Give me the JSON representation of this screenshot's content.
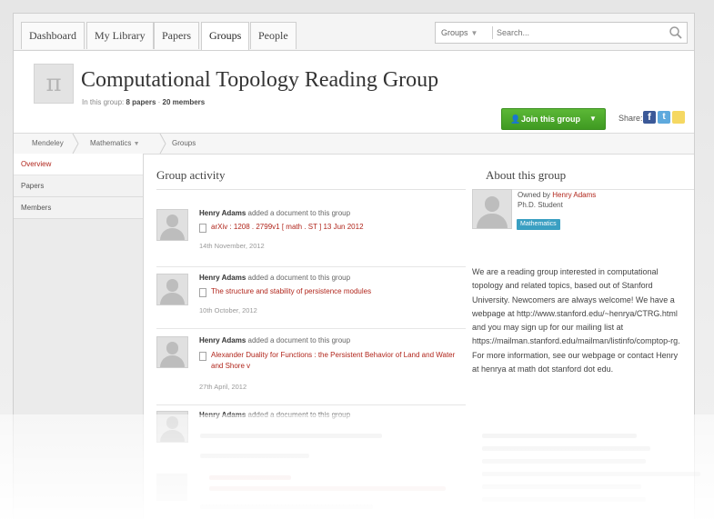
{
  "nav": {
    "tabs": [
      {
        "label": "Dashboard",
        "active": false
      },
      {
        "label": "My Library",
        "active": false
      },
      {
        "label": "Papers",
        "active": false
      },
      {
        "label": "Groups",
        "active": true
      },
      {
        "label": "People",
        "active": false
      }
    ],
    "search": {
      "scope": "Groups",
      "placeholder": "Search..."
    }
  },
  "group": {
    "logo_glyph": "π",
    "title": "Computational Topology Reading Group",
    "meta": {
      "prefix": "In this group:",
      "papers": "8 papers",
      "members": "20 members"
    },
    "join_label": "Join this group",
    "share_label": "Share:"
  },
  "breadcrumb": [
    "Mendeley",
    "Mathematics",
    "Groups"
  ],
  "sidebar": {
    "items": [
      {
        "label": "Overview",
        "active": true
      },
      {
        "label": "Papers",
        "active": false
      },
      {
        "label": "Members",
        "active": false
      }
    ]
  },
  "activity": {
    "heading": "Group activity",
    "items": [
      {
        "user": "Henry Adams",
        "action": "added a document to this group",
        "doc": "arXiv : 1208 . 2799v1 [ math . ST ] 13 Jun 2012",
        "date": "14th November, 2012"
      },
      {
        "user": "Henry Adams",
        "action": "added a document to this group",
        "doc": "The structure and stability of persistence modules",
        "date": "10th October, 2012"
      },
      {
        "user": "Henry Adams",
        "action": "added a document to this group",
        "doc": "Alexander Duality for Functions : the Persistent Behavior of Land and Water and Shore v",
        "date": "27th April, 2012"
      },
      {
        "user": "Henry Adams",
        "action": "added a document to this group",
        "doc": "",
        "date": ""
      }
    ]
  },
  "about": {
    "heading": "About this group",
    "owned_by_prefix": "Owned by",
    "owner": "Henry Adams",
    "owner_title": "Ph.D. Student",
    "tag": "Mathematics",
    "description": "We are a reading group interested in computational topology and related topics, based out of Stanford University. Newcomers are always welcome! We have a webpage at http://www.stanford.edu/~henrya/CTRG.html and you may sign up for our mailing list at https://mailman.stanford.edu/mailman/listinfo/comptop-rg. For more information, see our webpage or contact Henry at henrya at math dot stanford dot edu."
  },
  "colors": {
    "accent": "#b1261c",
    "join_green": "#4caf2b",
    "tag_blue": "#3a9fc2"
  }
}
